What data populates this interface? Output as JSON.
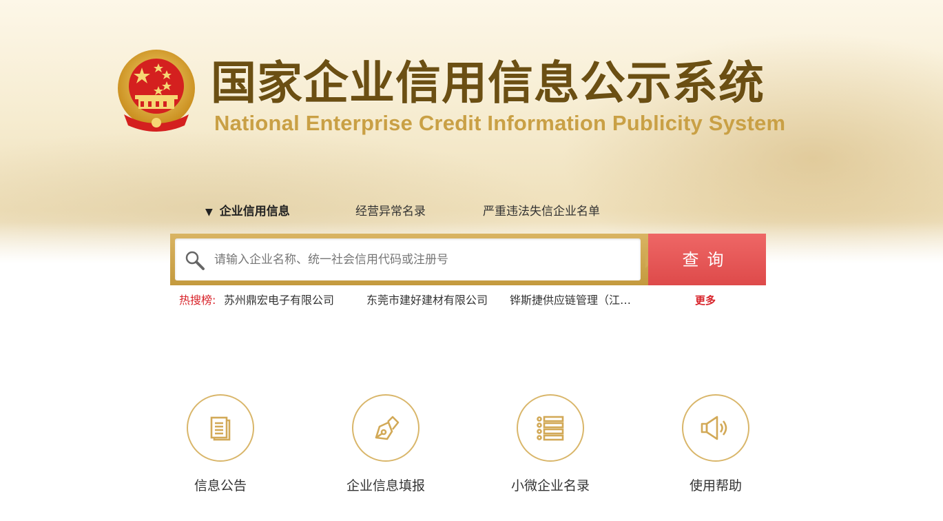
{
  "header": {
    "title_cn": "国家企业信用信息公示系统",
    "title_en": "National Enterprise Credit Information Publicity System",
    "emblem_icon": "national-emblem-icon"
  },
  "tabs": [
    {
      "label": "企业信用信息",
      "active": true,
      "marker": "▼"
    },
    {
      "label": "经营异常名录",
      "active": false
    },
    {
      "label": "严重违法失信企业名单",
      "active": false
    }
  ],
  "search": {
    "placeholder": "请输入企业名称、统一社会信用代码或注册号",
    "value": "",
    "button_label": "查询",
    "icon": "search-icon"
  },
  "hot_search": {
    "label": "热搜榜:",
    "items": [
      "苏州鼎宏电子有限公司",
      "东莞市建好建材有限公司",
      "铧斯捷供应链管理（江…"
    ],
    "more_label": "更多"
  },
  "features": [
    {
      "label": "信息公告",
      "icon": "document-icon"
    },
    {
      "label": "企业信息填报",
      "icon": "pen-nib-icon"
    },
    {
      "label": "小微企业名录",
      "icon": "list-icon"
    },
    {
      "label": "使用帮助",
      "icon": "speaker-icon"
    }
  ],
  "colors": {
    "title_brown": "#6b4f13",
    "title_gold": "#c9a045",
    "search_frame": "#c49a3e",
    "search_button": "#e35554",
    "hot_red": "#d8232a",
    "icon_gold": "#d9b66a"
  }
}
